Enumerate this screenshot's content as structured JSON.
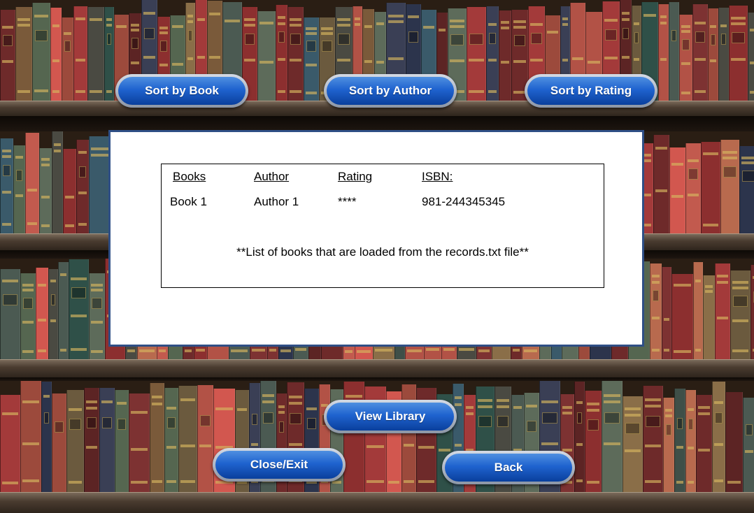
{
  "buttons": {
    "sort_by_book": "Sort by Book",
    "sort_by_author": "Sort by Author",
    "sort_by_rating": "Sort by Rating",
    "view_library": "View Library",
    "close_exit": "Close/Exit",
    "back": "Back"
  },
  "table": {
    "headers": [
      "Books",
      "Author",
      "Rating",
      "ISBN:"
    ],
    "rows": [
      [
        "Book 1",
        "Author 1",
        "****",
        "981-244345345"
      ]
    ],
    "note": "**List of books that are loaded from the records.txt file**"
  },
  "colors": {
    "button_blue": "#1f63cf",
    "panel_border": "#2f4f86"
  }
}
